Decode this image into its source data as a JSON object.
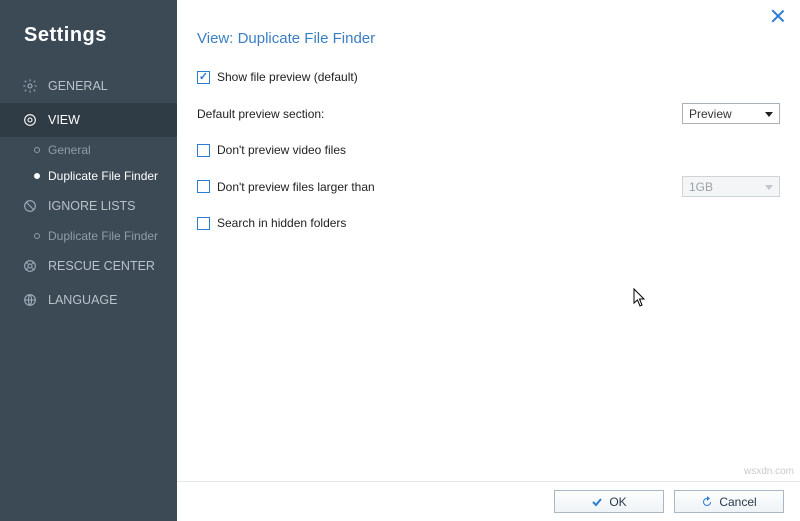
{
  "sidebar": {
    "title": "Settings",
    "items": [
      {
        "label": "GENERAL"
      },
      {
        "label": "VIEW"
      },
      {
        "label": "IGNORE LISTS"
      },
      {
        "label": "RESCUE CENTER"
      },
      {
        "label": "LANGUAGE"
      }
    ],
    "view_sub": [
      {
        "label": "General"
      },
      {
        "label": "Duplicate File Finder"
      }
    ],
    "ignore_sub": [
      {
        "label": "Duplicate File Finder"
      }
    ]
  },
  "main": {
    "title": "View: Duplicate File Finder",
    "show_preview_label": "Show file preview (default)",
    "default_section_label": "Default preview section:",
    "default_section_value": "Preview",
    "no_video_label": "Don't preview video files",
    "no_large_label": "Don't preview files larger than",
    "no_large_value": "1GB",
    "hidden_label": "Search in hidden folders"
  },
  "footer": {
    "ok": "OK",
    "cancel": "Cancel"
  },
  "watermark": "wsxdn.com"
}
